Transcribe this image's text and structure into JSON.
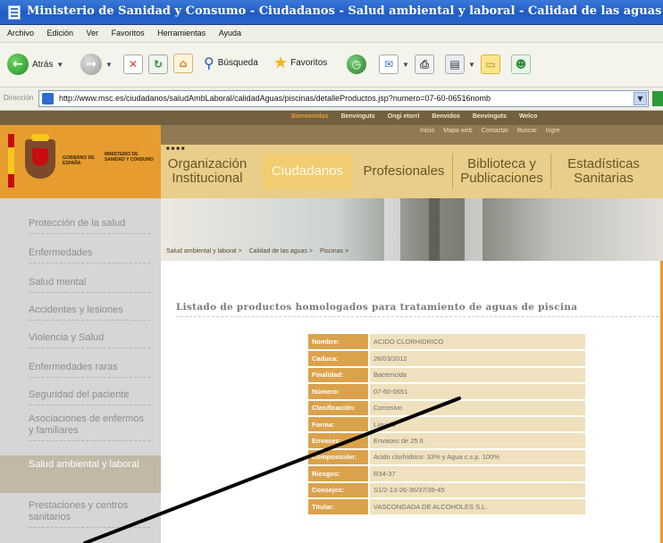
{
  "window": {
    "title": "Ministerio de Sanidad y Consumo - Ciudadanos - Salud ambiental y laboral - Calidad de las aguas - Microsoft"
  },
  "menubar": {
    "items": [
      "Archivo",
      "Edición",
      "Ver",
      "Favoritos",
      "Herramientas",
      "Ayuda"
    ]
  },
  "toolbar": {
    "back_label": "Atrás",
    "search_label": "Búsqueda",
    "favorites_label": "Favoritos"
  },
  "addressbar": {
    "label": "Dirección",
    "url": "http://www.msc.es/ciudadanos/saludAmbLaboral/calidadAguas/piscinas/detalleProductos.jsp?numero=07-60-06516nomb"
  },
  "site": {
    "top_links": [
      "Bienvenidos",
      "Benvinguts",
      "Ongi etorri",
      "Benvidos",
      "Benvinguts",
      "Welco"
    ],
    "sub_links": [
      "Inicio",
      "Mapa web",
      "Contactar",
      "Buscar",
      "Ingre"
    ],
    "logo_line1": "GOBIERNO DE ESPAÑA",
    "logo_line2": "MINISTERIO DE SANIDAD Y CONSUMO",
    "tabs": [
      "Organización Institucional",
      "Ciudadanos",
      "Profesionales",
      "Biblioteca y Publicaciones",
      "Estadísticas Sanitarias"
    ],
    "breadcrumb": [
      "Salud ambiental y laboral >",
      "Calidad de las aguas >",
      "Piscinas >"
    ]
  },
  "leftnav": {
    "items": [
      "Protección de la salud",
      "Enfermedades",
      "Salud mental",
      "Accidentes y lesiones",
      "Violencia y Salud",
      "Enfermedades raras",
      "Seguridad del paciente",
      "Asociaciones de enfermos y familiares",
      "Salud ambiental y laboral",
      "Prestaciones y centros sanitarios"
    ]
  },
  "main": {
    "heading": "Listado de productos homologados para tratamiento de aguas de piscina",
    "rows": [
      {
        "key": "Nombre:",
        "value": "ACIDO CLORHIDRICO"
      },
      {
        "key": "Caduca:",
        "value": "26/03/2012"
      },
      {
        "key": "Finalidad:",
        "value": "Bactericida"
      },
      {
        "key": "Número:",
        "value": "07-60-0651"
      },
      {
        "key": "Clasificación:",
        "value": "Corrosivo"
      },
      {
        "key": "Forma:",
        "value": "Líquido"
      },
      {
        "key": "Envases:",
        "value": "Envases de 25 lt."
      },
      {
        "key": "Composición:",
        "value": "Acido clorhídrico: 33% y Agua c.s.p. 100%"
      },
      {
        "key": "Riesgos:",
        "value": "R34-37"
      },
      {
        "key": "Consejos:",
        "value": "S1/2-13-26-36/37/39-45"
      },
      {
        "key": "Titular:",
        "value": "VASCONGADA DE ALCOHOLES S.L."
      }
    ]
  },
  "colors": {
    "accent_orange": "#e79a28",
    "header_brown": "#73603f",
    "table_key": "#dba24c",
    "table_value": "#efe1bd"
  }
}
